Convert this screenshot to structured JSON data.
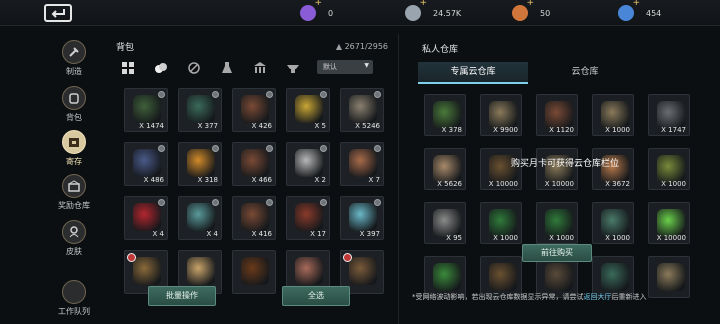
{
  "topbar": {
    "currencies": [
      {
        "name": "purple-gem",
        "value": "0",
        "color": "#8a5cd6"
      },
      {
        "name": "silver-coin",
        "value": "24.57K",
        "color": "#9aa4ae"
      },
      {
        "name": "copper-coin",
        "value": "50",
        "color": "#d0763b"
      },
      {
        "name": "blue-crystal",
        "value": "454",
        "color": "#4a86d8"
      }
    ]
  },
  "sidebar": {
    "items": [
      {
        "label": "制造",
        "icon": "hammer-icon"
      },
      {
        "label": "背包",
        "icon": "backpack-icon"
      },
      {
        "label": "寄存",
        "icon": "storage-icon"
      },
      {
        "label": "奖励仓库",
        "icon": "reward-chest-icon"
      },
      {
        "label": "皮肤",
        "icon": "skin-icon"
      }
    ],
    "active_index": 2,
    "work_queue_label": "工作队列"
  },
  "bag": {
    "title": "背包",
    "capacity": "2671/2956",
    "sort_value": "默认",
    "filters": [
      "all-grid-icon",
      "materials-icon",
      "no-weapon-icon",
      "flask-icon",
      "building-icon",
      "anvil-icon"
    ],
    "slots": [
      {
        "qty": "X 1474",
        "art": "#3f5f3a",
        "pin": true
      },
      {
        "qty": "X 377",
        "art": "#3b6a5a",
        "pin": true
      },
      {
        "qty": "X 426",
        "art": "#7a4a35",
        "pin": true
      },
      {
        "qty": "X 5",
        "art": "#c9a634",
        "pin": true
      },
      {
        "qty": "X 5246",
        "art": "#8a8070",
        "pin": true
      },
      {
        "qty": "X 486",
        "art": "#4a5a8a",
        "pin": true
      },
      {
        "qty": "X 318",
        "art": "#d28a2a",
        "pin": true
      },
      {
        "qty": "X 466",
        "art": "#7a4a35",
        "pin": true
      },
      {
        "qty": "X 2",
        "art": "#b8b8b8",
        "pin": true
      },
      {
        "qty": "X 7",
        "art": "#a86a4a",
        "pin": true
      },
      {
        "qty": "X 4",
        "art": "#b3262e",
        "pin": true
      },
      {
        "qty": "X 4",
        "art": "#5a9a9a",
        "pin": true
      },
      {
        "qty": "X 416",
        "art": "#7a4a35",
        "pin": true
      },
      {
        "qty": "X 17",
        "art": "#8a3a2a",
        "pin": true
      },
      {
        "qty": "X 397",
        "art": "#6ab8c8",
        "pin": true
      },
      {
        "qty": "",
        "art": "#8a6a3a",
        "pin": false,
        "red": true
      },
      {
        "qty": "",
        "art": "#c9a46a",
        "pin": false
      },
      {
        "qty": "",
        "art": "#6a3a1a",
        "pin": false
      },
      {
        "qty": "",
        "art": "#a86a5a",
        "pin": false
      },
      {
        "qty": "",
        "art": "#7a5a3a",
        "pin": false,
        "red": true
      }
    ],
    "batch_label": "批量操作",
    "select_all_label": "全选"
  },
  "warehouse": {
    "title": "私人仓库",
    "tabs": [
      "专属云仓库",
      "云仓库"
    ],
    "active_tab": 0,
    "locked_text": "购买月卡可获得云仓库栏位",
    "go_buy_label": "前往购买",
    "slots": [
      {
        "qty": "X 378",
        "art": "#4a7a3a"
      },
      {
        "qty": "X 9900",
        "art": "#8a7a5a"
      },
      {
        "qty": "X 1120",
        "art": "#7a4a35"
      },
      {
        "qty": "X 1000",
        "art": "#8a7a5a"
      },
      {
        "qty": "X 1747",
        "art": "#6a6e72"
      },
      {
        "qty": "X 5626",
        "art": "#a88a6a"
      },
      {
        "qty": "X 10000",
        "art": "#6a5030"
      },
      {
        "qty": "X 10000",
        "art": "#8a7a5a"
      },
      {
        "qty": "X 3672",
        "art": "#b87a4a"
      },
      {
        "qty": "X 1000",
        "art": "#7a8a3a"
      },
      {
        "qty": "X 95",
        "art": "#8a8a8a"
      },
      {
        "qty": "X 1000",
        "art": "#2f7a3a"
      },
      {
        "qty": "X 1000",
        "art": "#2f7a3a"
      },
      {
        "qty": "X 1000",
        "art": "#4a7a6a"
      },
      {
        "qty": "X 10000",
        "art": "#6ad04a"
      },
      {
        "qty": "",
        "art": "#3a8a3a"
      },
      {
        "qty": "",
        "art": "#6a5030"
      },
      {
        "qty": "",
        "art": "#5a4a3a"
      },
      {
        "qty": "",
        "art": "#3a6a5a"
      },
      {
        "qty": "",
        "art": "#8a7a5a"
      }
    ]
  },
  "notice": {
    "prefix": "*受网络波动影响，若出现云仓库数据显示异常，请尝试",
    "link": "返回大厅",
    "suffix": "后重新进入"
  }
}
